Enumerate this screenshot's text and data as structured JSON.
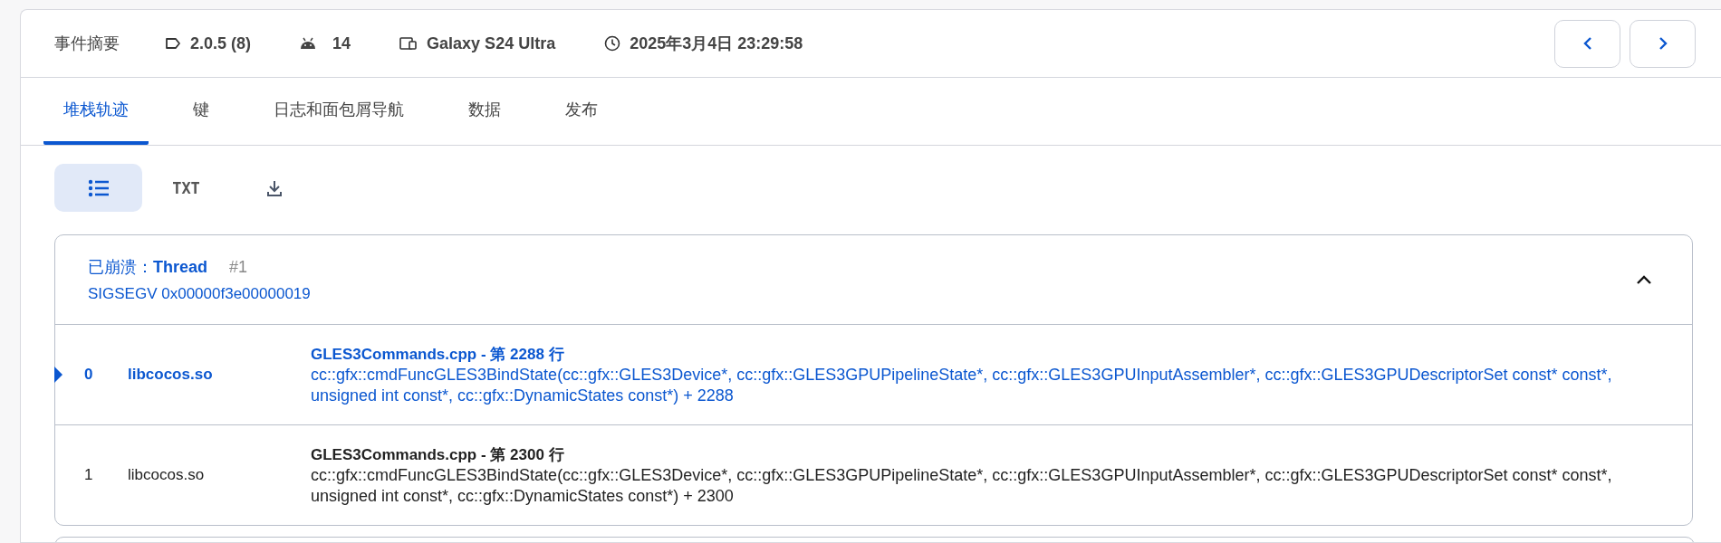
{
  "summary": {
    "title": "事件摘要",
    "version": "2.0.5 (8)",
    "os": "14",
    "device": "Galaxy S24 Ultra",
    "time": "2025年3月4日 23:29:58"
  },
  "tabs": [
    {
      "label": "堆栈轨迹",
      "selected": true
    },
    {
      "label": "键",
      "selected": false
    },
    {
      "label": "日志和面包屑导航",
      "selected": false
    },
    {
      "label": "数据",
      "selected": false
    },
    {
      "label": "发布",
      "selected": false
    }
  ],
  "toolbar": [
    {
      "kind": "list",
      "selected": true
    },
    {
      "kind": "text",
      "label": "TXT",
      "selected": false
    },
    {
      "kind": "download",
      "selected": false
    }
  ],
  "thread": {
    "prefix": "已崩溃：",
    "name": "Thread",
    "number": "#1",
    "signal": "SIGSEGV 0x00000f3e00000019",
    "expanded": true,
    "frames": [
      {
        "index": "0",
        "library": "libcocos.so",
        "location": "GLES3Commands.cpp - 第 2288 行",
        "symbol": "cc::gfx::cmdFuncGLES3BindState(cc::gfx::GLES3Device*, cc::gfx::GLES3GPUPipelineState*, cc::gfx::GLES3GPUInputAssembler*, cc::gfx::GLES3GPUDescriptorSet const* const*, unsigned int const*, cc::gfx::DynamicStates const*) + 2288",
        "selected": true
      },
      {
        "index": "1",
        "library": "libcocos.so",
        "location": "GLES3Commands.cpp - 第 2300 行",
        "symbol": "cc::gfx::cmdFuncGLES3BindState(cc::gfx::GLES3Device*, cc::gfx::GLES3GPUPipelineState*, cc::gfx::GLES3GPUInputAssembler*, cc::gfx::GLES3GPUDescriptorSet const* const*, unsigned int const*, cc::gfx::DynamicStates const*) + 2300",
        "selected": false
      }
    ]
  }
}
